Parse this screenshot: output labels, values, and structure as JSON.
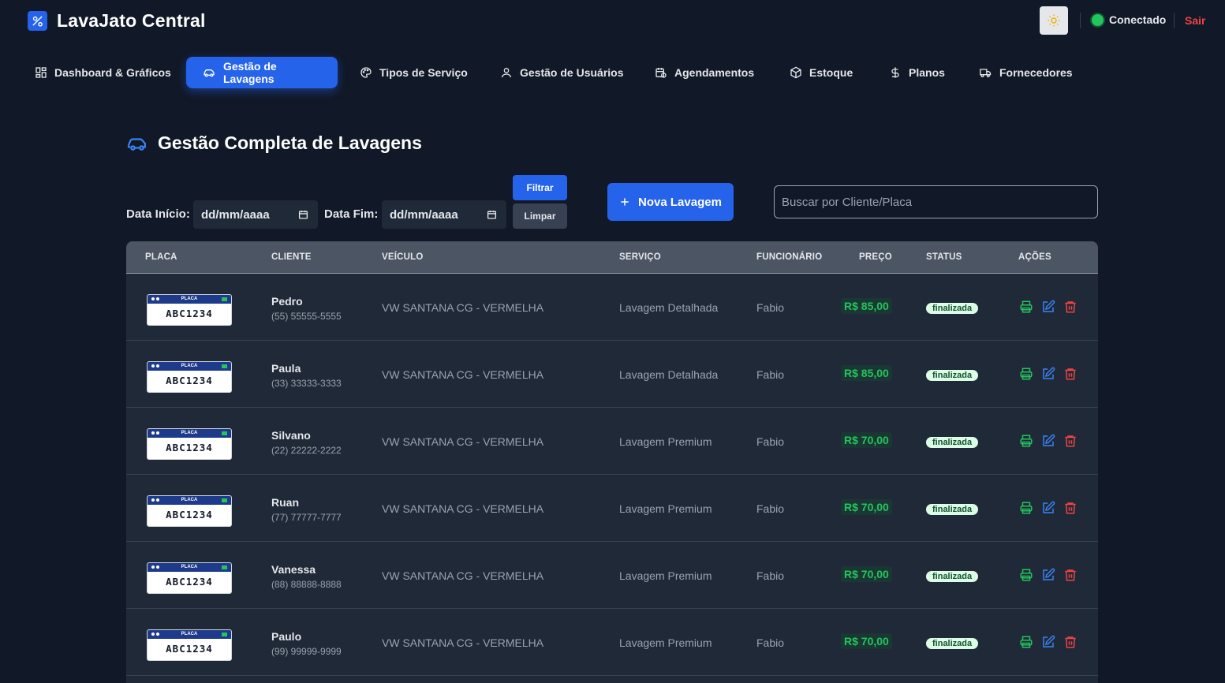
{
  "app": {
    "title": "LavaJato Central"
  },
  "header": {
    "connection_label": "Conectado",
    "logout_label": "Sair"
  },
  "nav": {
    "items": [
      {
        "label": "Dashboard & Gráficos",
        "icon": "grid-icon"
      },
      {
        "label": "Gestão de Lavagens",
        "icon": "car-icon",
        "active": true
      },
      {
        "label": "Tipos de Serviço",
        "icon": "palette-icon"
      },
      {
        "label": "Gestão de Usuários",
        "icon": "user-icon"
      },
      {
        "label": "Agendamentos",
        "icon": "calendar-clock-icon"
      },
      {
        "label": "Estoque",
        "icon": "box-icon"
      },
      {
        "label": "Planos",
        "icon": "dollar-icon"
      },
      {
        "label": "Fornecedores",
        "icon": "truck-icon"
      }
    ]
  },
  "page": {
    "title": "Gestão Completa de Lavagens"
  },
  "filters": {
    "start_label": "Data Início:",
    "start_value": "dd/mm/aaaa",
    "end_label": "Data Fim:",
    "end_value": "dd/mm/aaaa",
    "filter_button": "Filtrar",
    "clear_button": "Limpar",
    "new_button": "Nova Lavagem",
    "search_placeholder": "Buscar por Cliente/Placa"
  },
  "table": {
    "headers": [
      "PLACA",
      "CLIENTE",
      "VEÍCULO",
      "SERVIÇO",
      "FUNCIONÁRIO",
      "PREÇO",
      "STATUS",
      "AÇÕES"
    ],
    "plate_header_text": "PLACA",
    "rows": [
      {
        "plate": "ABC1234",
        "client": "Pedro",
        "phone": "(55) 55555-5555",
        "vehicle": "VW SANTANA CG - VERMELHA",
        "service": "Lavagem Detalhada",
        "employee": "Fabio",
        "price": "R$ 85,00",
        "status": "finalizada"
      },
      {
        "plate": "ABC1234",
        "client": "Paula",
        "phone": "(33) 33333-3333",
        "vehicle": "VW SANTANA CG - VERMELHA",
        "service": "Lavagem Detalhada",
        "employee": "Fabio",
        "price": "R$ 85,00",
        "status": "finalizada"
      },
      {
        "plate": "ABC1234",
        "client": "Silvano",
        "phone": "(22) 22222-2222",
        "vehicle": "VW SANTANA CG - VERMELHA",
        "service": "Lavagem Premium",
        "employee": "Fabio",
        "price": "R$ 70,00",
        "status": "finalizada"
      },
      {
        "plate": "ABC1234",
        "client": "Ruan",
        "phone": "(77) 77777-7777",
        "vehicle": "VW SANTANA CG - VERMELHA",
        "service": "Lavagem Premium",
        "employee": "Fabio",
        "price": "R$ 70,00",
        "status": "finalizada"
      },
      {
        "plate": "ABC1234",
        "client": "Vanessa",
        "phone": "(88) 88888-8888",
        "vehicle": "VW SANTANA CG - VERMELHA",
        "service": "Lavagem Premium",
        "employee": "Fabio",
        "price": "R$ 70,00",
        "status": "finalizada"
      },
      {
        "plate": "ABC1234",
        "client": "Paulo",
        "phone": "(99) 99999-9999",
        "vehicle": "VW SANTANA CG - VERMELHA",
        "service": "Lavagem Premium",
        "employee": "Fabio",
        "price": "R$ 70,00",
        "status": "finalizada"
      }
    ]
  },
  "colors": {
    "background": "#111827",
    "accent": "#2563eb",
    "success": "#22c55e",
    "danger": "#ef4444"
  }
}
